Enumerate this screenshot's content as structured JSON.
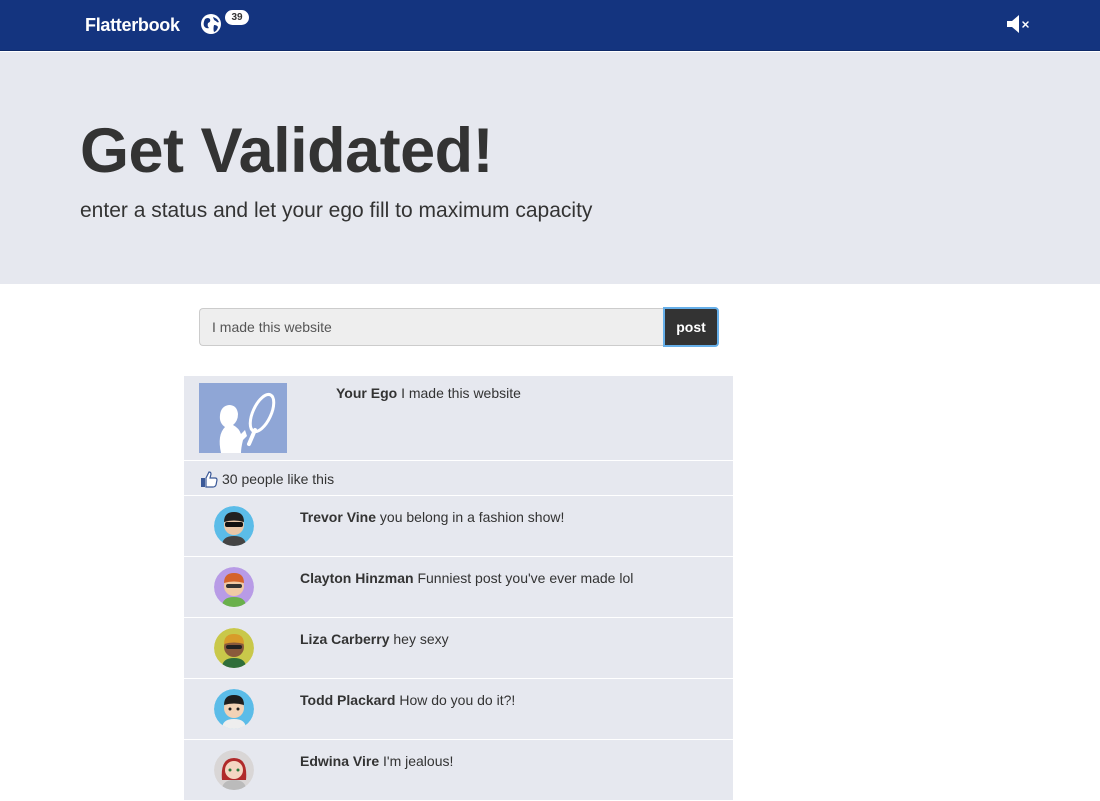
{
  "navbar": {
    "brand": "Flatterbook",
    "notification_count": "39",
    "icons": {
      "globe": "globe-icon",
      "mute": "speaker-muted-icon"
    }
  },
  "hero": {
    "title": "Get Validated!",
    "subtitle": "enter a status and let your ego fill to maximum capacity"
  },
  "composer": {
    "value": "I made this website",
    "post_label": "post"
  },
  "post": {
    "author": "Your Ego",
    "text": "I made this website",
    "likes": "30 people like this"
  },
  "comments": [
    {
      "name": "Trevor Vine",
      "text": "you belong in a fashion show!",
      "avatar_bg": "#5bbce8"
    },
    {
      "name": "Clayton Hinzman",
      "text": "Funniest post you've ever made lol",
      "avatar_bg": "#b89be6"
    },
    {
      "name": "Liza Carberry",
      "text": "hey sexy",
      "avatar_bg": "#c9c84a"
    },
    {
      "name": "Todd Plackard",
      "text": "How do you do it?!",
      "avatar_bg": "#5bbce8"
    },
    {
      "name": "Edwina Vire",
      "text": "I'm jealous!",
      "avatar_bg": "#d9d6d6"
    }
  ],
  "colors": {
    "navbar": "#14347f",
    "hero_bg": "#e6e8ef",
    "feed_bg": "#e6e8ef",
    "post_button": "#333333",
    "ego_silhouette_bg": "#8fa6d6"
  }
}
